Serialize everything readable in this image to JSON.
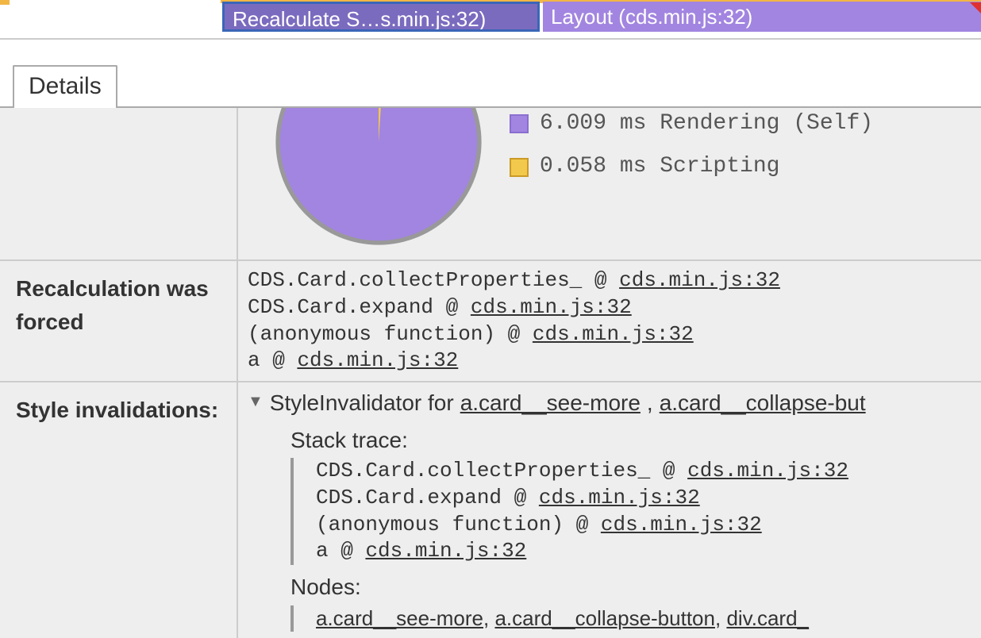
{
  "timeline": {
    "bar1_label": "Recalculate S…s.min.js:32)",
    "bar2_label": "Layout (cds.min.js:32)"
  },
  "tab": {
    "details_label": "Details"
  },
  "chart_data": {
    "type": "pie",
    "series": [
      {
        "name": "Rendering (Self)",
        "value": 6.009,
        "unit": "ms",
        "color": "#a285e0"
      },
      {
        "name": "Scripting",
        "value": 0.058,
        "unit": "ms",
        "color": "#f2c94c"
      }
    ]
  },
  "legend": {
    "rendering_text": "6.009 ms Rendering (Self)",
    "scripting_text": "0.058 ms Scripting"
  },
  "colors": {
    "rendering": "#a285e0",
    "scripting": "#f2c94c",
    "rendering_border": "#8a6fd0",
    "scripting_border": "#cc9a28"
  },
  "labels": {
    "recalc_forced": "Recalculation was forced",
    "style_invalidations": "Style invalidations:",
    "stack_trace": "Stack trace",
    "nodes": "Nodes"
  },
  "forced_stack": [
    {
      "fn": "CDS.Card.collectProperties_",
      "at": "@",
      "src": "cds.min.js:32"
    },
    {
      "fn": "CDS.Card.expand",
      "at": "@",
      "src": "cds.min.js:32"
    },
    {
      "fn": "(anonymous function)",
      "at": "@",
      "src": "cds.min.js:32"
    },
    {
      "fn": "a",
      "at": "@",
      "src": "cds.min.js:32"
    }
  ],
  "style_inv": {
    "head_prefix": "StyleInvalidator for ",
    "head_sel1": "a.card__see-more",
    "head_sep": ", ",
    "head_sel2": "a.card__collapse-but",
    "stack": [
      {
        "fn": "CDS.Card.collectProperties_",
        "at": "@",
        "src": "cds.min.js:32"
      },
      {
        "fn": "CDS.Card.expand",
        "at": "@",
        "src": "cds.min.js:32"
      },
      {
        "fn": "(anonymous function)",
        "at": "@",
        "src": "cds.min.js:32"
      },
      {
        "fn": "a",
        "at": "@",
        "src": "cds.min.js:32"
      }
    ],
    "nodes": [
      "a.card__see-more",
      "a.card__collapse-button",
      "div.card_"
    ]
  }
}
